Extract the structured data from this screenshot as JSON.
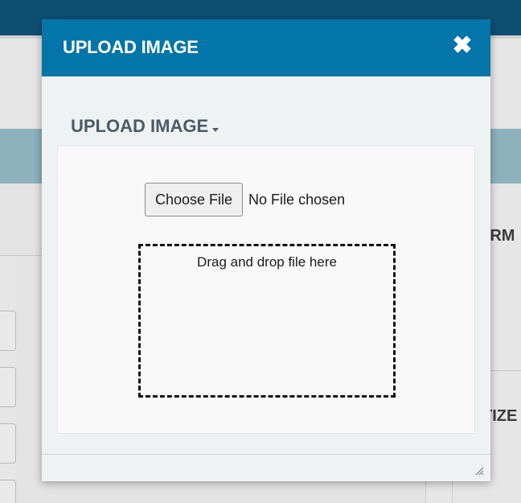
{
  "background": {
    "heading_1": "ERM",
    "heading_2": "TIZE"
  },
  "modal": {
    "title": "UPLOAD IMAGE",
    "close_glyph": "✖",
    "section": {
      "title": "UPLOAD IMAGE",
      "dropdown_icon": "caret-down-icon"
    },
    "file_input": {
      "button_label": "Choose File",
      "status_text": "No File chosen"
    },
    "drop_zone": {
      "text": "Drag and drop file here"
    },
    "resize_icon": "resize-grip-icon"
  },
  "colors": {
    "header": "#0375a8",
    "modal_bg": "#eff2f3",
    "section_title": "#4a5b68",
    "app_topbar": "#0f4f73"
  }
}
